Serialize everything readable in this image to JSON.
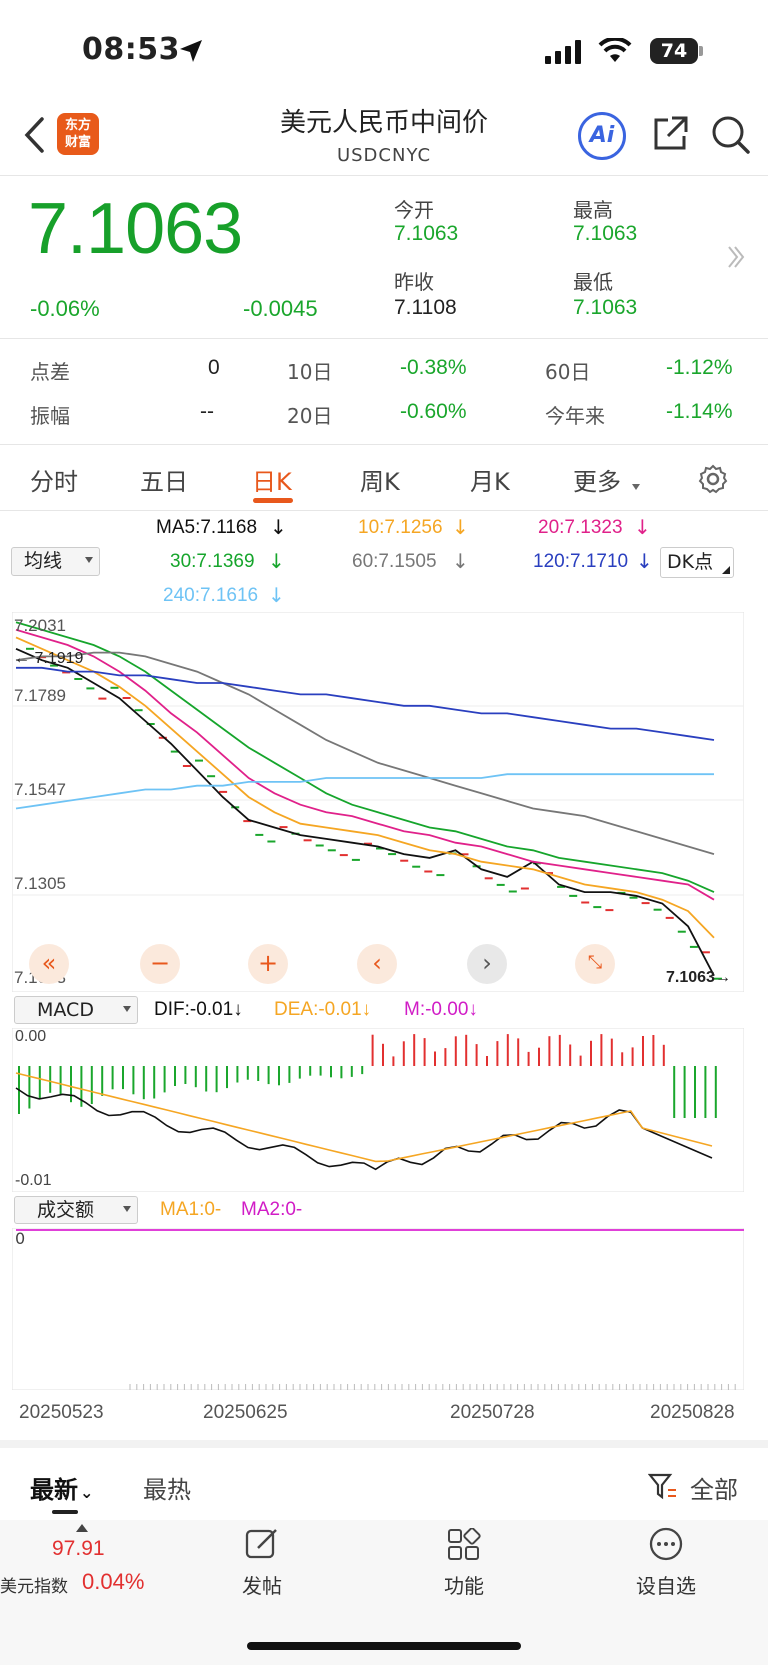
{
  "status_bar": {
    "time": "08:53",
    "battery": "74"
  },
  "header": {
    "title": "美元人民币中间价",
    "code": "USDCNYC",
    "logo_line1": "东方",
    "logo_line2": "财富",
    "ai_label": "Ai"
  },
  "quote": {
    "price": "7.1063",
    "change_pct": "-0.06%",
    "change": "-0.0045",
    "open_label": "今开",
    "open": "7.1063",
    "prev_close_label": "昨收",
    "prev_close": "7.1108",
    "high_label": "最高",
    "high": "7.1063",
    "low_label": "最低",
    "low": "7.1063"
  },
  "stats": [
    {
      "label": "点差",
      "value": "0",
      "label2": "10日",
      "value2": "-0.38%",
      "label3": "60日",
      "value3": "-1.12%"
    },
    {
      "label": "振幅",
      "value": "--",
      "label2": "20日",
      "value2": "-0.60%",
      "label3": "今年来",
      "value3": "-1.14%"
    }
  ],
  "tabs": [
    "分时",
    "五日",
    "日K",
    "周K",
    "月K",
    "更多"
  ],
  "ma_legend": {
    "selector": "均线",
    "ma5": "MA5:7.1168",
    "ma10": "10:7.1256",
    "ma20": "20:7.1323",
    "ma30": "30:7.1369",
    "ma60": "60:7.1505",
    "ma120": "120:7.1710",
    "ma240": "240:7.1616",
    "dk": "DK点"
  },
  "colors": {
    "ma5": "#111111",
    "ma10": "#f5a623",
    "ma20": "#e0218a",
    "ma30": "#16a52c",
    "ma60": "#777777",
    "ma120": "#2a3fbf",
    "ma240": "#6ec3f5",
    "up": "#e23030",
    "down": "#1aa62c"
  },
  "price_axis": {
    "t1": "7.2031",
    "t2": "7.1789",
    "t3": "7.1547",
    "t4": "7.1305",
    "t5": "7.1063",
    "high_marker": "7.1919",
    "last_marker": "7.1063"
  },
  "macd": {
    "selector": "MACD",
    "dif": "DIF:-0.01",
    "dea": "DEA:-0.01",
    "m": "M:-0.00",
    "top": "0.00",
    "bottom": "-0.01"
  },
  "volume": {
    "selector": "成交额",
    "ma1": "MA1:0-",
    "ma2": "MA2:0-",
    "zero": "0"
  },
  "dates": [
    "20250523",
    "20250625",
    "20250728",
    "20250828"
  ],
  "chart_data": {
    "type": "line",
    "title": "美元人民币中间价 日K",
    "ylim": [
      7.1063,
      7.2031
    ],
    "series": [
      {
        "name": "MA5",
        "values": [
          7.195,
          7.192,
          7.19,
          7.186,
          7.182,
          7.176,
          7.17,
          7.163,
          7.156,
          7.15,
          7.148,
          7.146,
          7.145,
          7.144,
          7.143,
          7.141,
          7.14,
          7.142,
          7.137,
          7.135,
          7.139,
          7.133,
          7.131,
          7.131,
          7.13,
          7.128,
          7.122,
          7.109
        ]
      },
      {
        "name": "MA10",
        "values": [
          7.198,
          7.195,
          7.192,
          7.189,
          7.185,
          7.18,
          7.174,
          7.168,
          7.162,
          7.156,
          7.152,
          7.149,
          7.148,
          7.147,
          7.146,
          7.144,
          7.142,
          7.141,
          7.139,
          7.138,
          7.137,
          7.135,
          7.133,
          7.132,
          7.131,
          7.129,
          7.126,
          7.119
        ]
      },
      {
        "name": "MA20",
        "values": [
          7.2,
          7.198,
          7.196,
          7.193,
          7.189,
          7.184,
          7.178,
          7.173,
          7.167,
          7.161,
          7.157,
          7.154,
          7.152,
          7.151,
          7.149,
          7.147,
          7.146,
          7.144,
          7.143,
          7.141,
          7.139,
          7.138,
          7.137,
          7.136,
          7.135,
          7.134,
          7.133,
          7.129
        ]
      },
      {
        "name": "MA30",
        "values": [
          7.202,
          7.2,
          7.198,
          7.196,
          7.193,
          7.189,
          7.184,
          7.179,
          7.174,
          7.169,
          7.165,
          7.161,
          7.157,
          7.154,
          7.152,
          7.15,
          7.148,
          7.147,
          7.145,
          7.143,
          7.142,
          7.14,
          7.139,
          7.138,
          7.137,
          7.136,
          7.134,
          7.131
        ]
      },
      {
        "name": "MA60",
        "values": [
          7.192,
          7.193,
          7.193,
          7.194,
          7.194,
          7.193,
          7.191,
          7.189,
          7.186,
          7.183,
          7.179,
          7.175,
          7.171,
          7.168,
          7.165,
          7.163,
          7.161,
          7.159,
          7.157,
          7.155,
          7.153,
          7.152,
          7.151,
          7.149,
          7.147,
          7.145,
          7.143,
          7.141
        ]
      },
      {
        "name": "MA120",
        "values": [
          7.19,
          7.19,
          7.189,
          7.189,
          7.188,
          7.188,
          7.187,
          7.186,
          7.186,
          7.185,
          7.184,
          7.183,
          7.183,
          7.182,
          7.181,
          7.18,
          7.18,
          7.179,
          7.178,
          7.178,
          7.177,
          7.176,
          7.175,
          7.174,
          7.174,
          7.173,
          7.172,
          7.171
        ]
      },
      {
        "name": "MA240",
        "values": [
          7.153,
          7.154,
          7.155,
          7.156,
          7.157,
          7.158,
          7.158,
          7.159,
          7.159,
          7.16,
          7.16,
          7.16,
          7.161,
          7.161,
          7.161,
          7.161,
          7.161,
          7.161,
          7.161,
          7.162,
          7.162,
          7.162,
          7.162,
          7.162,
          7.162,
          7.162,
          7.162,
          7.162
        ]
      }
    ]
  }
}
